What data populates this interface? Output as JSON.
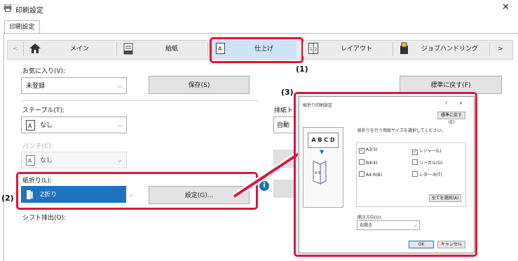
{
  "window": {
    "title": "印刷設定",
    "close_label": "✕",
    "tab": "印刷設定"
  },
  "nav": {
    "prev": "<",
    "next": ">",
    "tabs": [
      {
        "label": "メイン",
        "icon": "home-icon"
      },
      {
        "label": "給紙",
        "icon": "paper-tray-icon"
      },
      {
        "label": "仕上げ",
        "icon": "finishing-icon",
        "selected": true
      },
      {
        "label": "レイアウト",
        "icon": "layout-icon"
      },
      {
        "label": "ジョブハンドリング",
        "icon": "job-handling-icon"
      }
    ]
  },
  "favorites": {
    "label": "お気に入り(V):",
    "value": "未登録",
    "save": "保存(S)",
    "reset": "標準に戻す(F)"
  },
  "staple": {
    "label": "ステープル(T):",
    "value": "なし"
  },
  "exit_tray": {
    "label": "排紙ト",
    "value": "自動"
  },
  "punch": {
    "label": "パンチ(C):",
    "value": "なし"
  },
  "fold": {
    "label": "紙折り(L):",
    "value": "Z折り",
    "settings": "設定(G)..."
  },
  "shift": {
    "label": "シフト排出(O):"
  },
  "callouts": {
    "c1": "(1)",
    "c2": "(2)",
    "c3": "(3)"
  },
  "info_icon": "i",
  "dialog": {
    "title": "紙折り印刷設定",
    "help": "?",
    "close": "✕",
    "reset": "標準に戻す(E)",
    "preview_text": "A B C D",
    "preview_fold_text": "A B",
    "instruction": "紙折りを行う用紙サイズを選択してください。",
    "checks": [
      {
        "label": "A3(3)",
        "checked": true
      },
      {
        "label": "レジャー(L)",
        "checked": true
      },
      {
        "label": "B4(4)",
        "checked": false
      },
      {
        "label": "リーガル(G)",
        "checked": false
      },
      {
        "label": "A4-R(B)",
        "checked": false
      },
      {
        "label": "レター-R(T)",
        "checked": false
      }
    ],
    "select_all": "全てを選択(A)",
    "open_dir_label": "開き方向(O):",
    "open_dir_value": "右開き",
    "ok": "OK",
    "cancel": "キャンセル"
  },
  "colors": {
    "accent": "#e0143c",
    "selected_combo": "#1e73be"
  }
}
